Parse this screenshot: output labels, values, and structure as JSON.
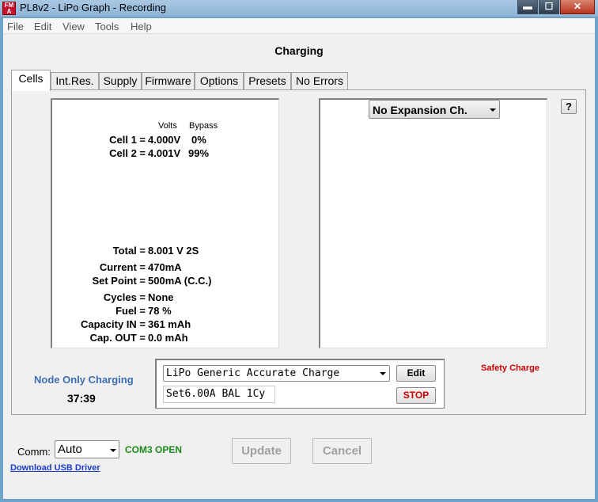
{
  "window": {
    "title": "PL8v2 - LiPo Graph - Recording",
    "icon_text_top": "FM",
    "icon_text_bottom": "A",
    "controls": {
      "minimize": "▬",
      "maximize": "☐",
      "close": "✕"
    }
  },
  "menu": [
    "File",
    "Edit",
    "View",
    "Tools",
    "Help"
  ],
  "heading": "Charging",
  "tabs": [
    "Cells",
    "Int.Res.",
    "Supply",
    "Firmware",
    "Options",
    "Presets",
    "No Errors"
  ],
  "cells_panel": {
    "header_volts": "Volts",
    "header_bypass": "Bypass",
    "cells": [
      {
        "label": "Cell 1 =",
        "volts": "4.000V",
        "bypass": "0%"
      },
      {
        "label": "Cell 2 =",
        "volts": "4.001V",
        "bypass": "99%"
      }
    ],
    "stats": [
      {
        "label": "Total =",
        "value": "8.001 V  2S"
      },
      {
        "label": "Current =",
        "value": "470mA"
      },
      {
        "label": "Set Point =",
        "value": "500mA  (C.C.)"
      },
      {
        "label": "Cycles =",
        "value": "None"
      },
      {
        "label": "Fuel =",
        "value": "78 %"
      },
      {
        "label": "Capacity IN =",
        "value": "361 mAh"
      },
      {
        "label": "Cap. OUT =",
        "value": "0.0 mAh"
      }
    ]
  },
  "expansion": {
    "selected": "No Expansion Ch."
  },
  "help_button": "?",
  "node_status": {
    "label": "Node Only Charging",
    "timer": "37:39",
    "color": "#3c6eb4"
  },
  "charge_program": {
    "selected": "LiPo Generic Accurate Charge",
    "summary": "Set6.00A BAL 1Cy",
    "edit_label": "Edit",
    "stop_label": "STOP"
  },
  "safety_label": "Safety Charge",
  "footer": {
    "comm_label": "Comm:",
    "comm_value": "Auto",
    "port_status": "COM3 OPEN",
    "update_label": "Update",
    "cancel_label": "Cancel",
    "driver_link": "Download USB Driver"
  },
  "colors": {
    "status_green": "#1a8a1a",
    "stop_red": "#cc0000",
    "link_blue": "#1a3cc8"
  }
}
